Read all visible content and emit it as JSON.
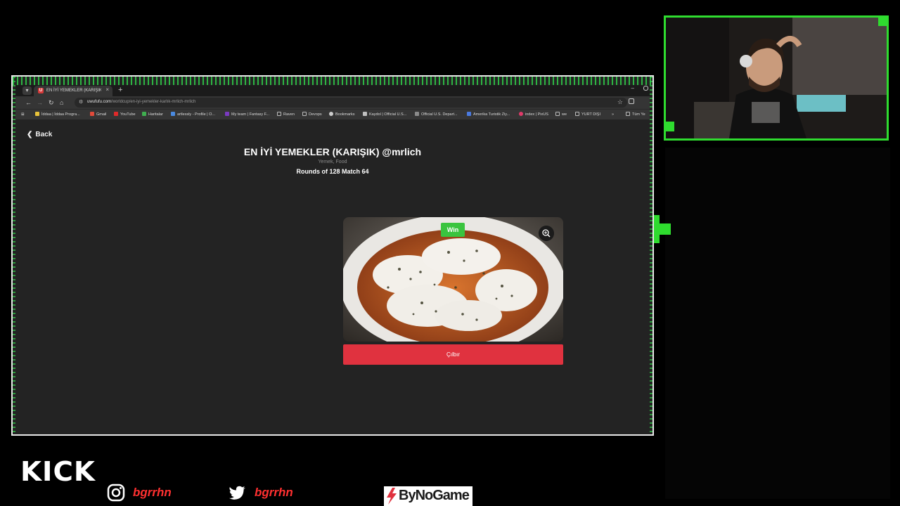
{
  "browser": {
    "tab": {
      "title": "EN İYİ YEMEKLER (KARIŞIK) @m",
      "close": "×",
      "new_tab": "+",
      "favicon": "U"
    },
    "window": {
      "minimize": "–"
    },
    "url": {
      "host": "uwufufu.com",
      "path": "/worldcup/en-iyi-yemekler-karlık-mrlich-mrlich"
    },
    "bookmarks": [
      {
        "label": "İddaa | İddaa Progra...",
        "color": "#e8c23a"
      },
      {
        "label": "Gmail",
        "color": "#e04a3a"
      },
      {
        "label": "YouTube",
        "color": "#e02a2a"
      },
      {
        "label": "Haritalar",
        "color": "#3fae4f"
      },
      {
        "label": "artlessly - Profile | O...",
        "color": "#4a8ae0"
      },
      {
        "label": "My team | Fantasy F...",
        "color": "#7a3ac0"
      },
      {
        "label": "Raven",
        "color": "#9a9a9a"
      },
      {
        "label": "Devops",
        "color": "#9a9a9a"
      },
      {
        "label": "Bookmarks",
        "color": "#cccccc"
      },
      {
        "label": "Kaydol | Official U.S...",
        "color": "#c0c0c0"
      },
      {
        "label": "Official U.S. Depart...",
        "color": "#8a8a8a"
      },
      {
        "label": "Amerika Turistik Ziy...",
        "color": "#4a7ae0"
      },
      {
        "label": "index | PixUS",
        "color": "#e03a6a"
      },
      {
        "label": "we",
        "color": "#9a9a9a"
      },
      {
        "label": "YURT DIŞI",
        "color": "#9a9a9a"
      },
      {
        "label": "»",
        "color": ""
      },
      {
        "label": "Tüm Ye",
        "color": "#9a9a9a"
      }
    ]
  },
  "page": {
    "back_label": "Back",
    "title": "EN İYİ YEMEKLER (KARIŞIK) @mrlich",
    "categories": "Yemek, Food",
    "round_info": "Rounds of 128 Match 64",
    "choice": {
      "badge": "Win",
      "button_label": "Çılbır"
    }
  },
  "branding": {
    "kick": "KICK",
    "instagram_handle": "bgrrhn",
    "twitter_handle": "bgrrhn",
    "sponsor": "ByNoGame"
  },
  "colors": {
    "accent_green": "#2fdc2f",
    "win_green": "#3ac43f",
    "choice_red": "#e0323f",
    "handle_red": "#ff3030"
  },
  "icons": {
    "back": "chevron-left-icon",
    "zoom": "zoom-in-icon",
    "instagram": "instagram-icon",
    "twitter": "twitter-icon"
  }
}
